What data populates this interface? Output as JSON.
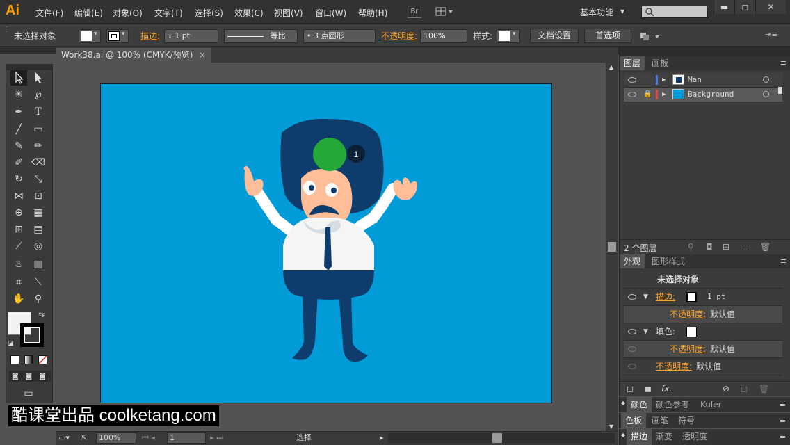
{
  "app": {
    "logo": "Ai"
  },
  "menu": [
    "文件(F)",
    "编辑(E)",
    "对象(O)",
    "文字(T)",
    "选择(S)",
    "效果(C)",
    "视图(V)",
    "窗口(W)",
    "帮助(H)"
  ],
  "topbar": {
    "bridge": "Br",
    "workspace": "基本功能",
    "workspace_arrow": "▾",
    "search_placeholder": "",
    "min": "▬",
    "restore": "◻",
    "close": "✕"
  },
  "control": {
    "no_selection": "未选择对象",
    "stroke_label": "描边:",
    "stroke_value": "1 pt",
    "profile": "等比",
    "brush": "3 点圆形",
    "opacity_label": "不透明度:",
    "opacity_value": "100%",
    "style_label": "样式:",
    "doc_setup": "文档设置",
    "prefs": "首选项"
  },
  "document": {
    "tab_title": "Work38.ai @ 100% (CMYK/预览)",
    "tab_close": "×"
  },
  "artwork": {
    "badge_number": "1"
  },
  "status": {
    "zoom": "100%",
    "page": "1",
    "tool": "选择"
  },
  "layers_panel": {
    "tabs": [
      "图层",
      "画板"
    ],
    "layers": [
      {
        "name": "Man",
        "color": "#4b7bd9"
      },
      {
        "name": "Background",
        "color": "#d94b4b"
      }
    ],
    "count": "2 个图层"
  },
  "appearance_panel": {
    "tabs": [
      "外观",
      "图形样式"
    ],
    "header": "未选择对象",
    "rows": [
      {
        "label": "描边:",
        "value": "1 pt"
      },
      {
        "label": "不透明度:",
        "value": "默认值"
      },
      {
        "label": "填色:",
        "value": ""
      },
      {
        "label": "不透明度:",
        "value": "默认值"
      },
      {
        "label": "不透明度:",
        "value": "默认值"
      }
    ],
    "fx": "fx."
  },
  "color_panel": {
    "tabs": [
      "颜色",
      "颜色参考",
      "Kuler"
    ]
  },
  "swatch_panel": {
    "tabs": [
      "色板",
      "画笔",
      "符号"
    ]
  },
  "stroke_panel": {
    "tabs": [
      "描边",
      "渐变",
      "透明度"
    ]
  },
  "watermark": "酷课堂出品 coolketang.com",
  "colors": {
    "canvas": "#019cd8",
    "hair": "#0e3c6c",
    "skin": "#ffbd98",
    "green": "#24a837",
    "accent": "#f7a02a"
  }
}
